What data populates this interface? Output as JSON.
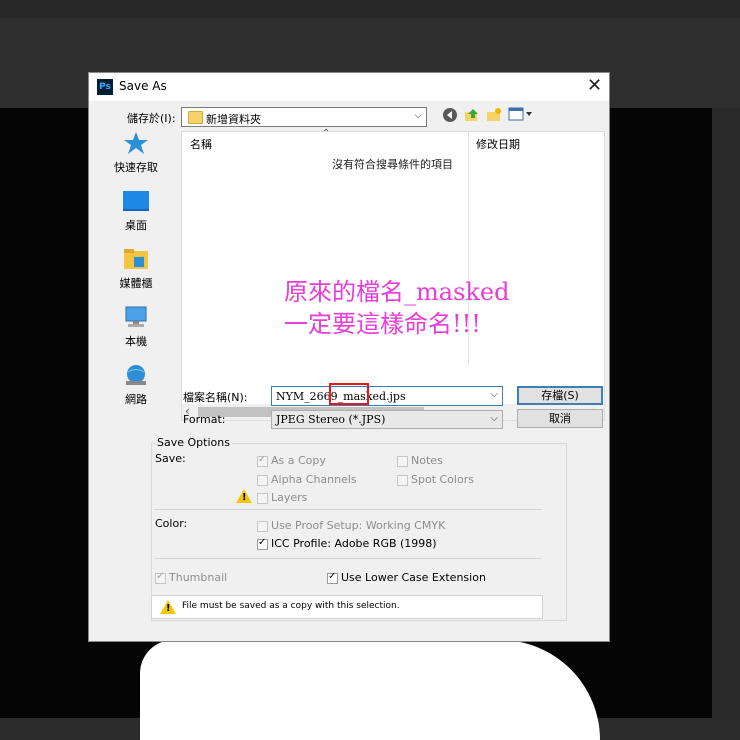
{
  "dialog": {
    "title": "Save As",
    "app_icon": "Ps"
  },
  "location": {
    "label": "儲存於(I):",
    "value": "新增資料夾"
  },
  "places": [
    {
      "label": "快速存取",
      "icon": "star-icon"
    },
    {
      "label": "桌面",
      "icon": "desktop-icon"
    },
    {
      "label": "媒體櫃",
      "icon": "library-icon"
    },
    {
      "label": "本機",
      "icon": "computer-icon"
    },
    {
      "label": "網路",
      "icon": "network-icon"
    }
  ],
  "filelist": {
    "columns": [
      "名稱",
      "修改日期"
    ],
    "empty_message": "沒有符合搜尋條件的項目"
  },
  "annotation": {
    "line1": "原來的檔名_masked",
    "line2": "一定要這樣命名!!!"
  },
  "filename": {
    "label": "檔案名稱(N):",
    "value": "NYM_2669_masked.jps"
  },
  "format": {
    "label": "Format:",
    "value": "JPEG Stereo (*.JPS)"
  },
  "buttons": {
    "save": "存檔(S)",
    "cancel": "取消"
  },
  "options": {
    "heading": "Save Options",
    "save_label": "Save:",
    "as_copy": "As a Copy",
    "notes": "Notes",
    "alpha_channels": "Alpha Channels",
    "spot_colors": "Spot Colors",
    "layers": "Layers",
    "color_label": "Color:",
    "use_proof": "Use Proof Setup:  Working CMYK",
    "icc_profile": "ICC Profile:  Adobe RGB (1998)",
    "thumbnail": "Thumbnail",
    "lower_case": "Use Lower Case Extension"
  },
  "warning": {
    "message": "File must be saved as a copy with this selection."
  }
}
